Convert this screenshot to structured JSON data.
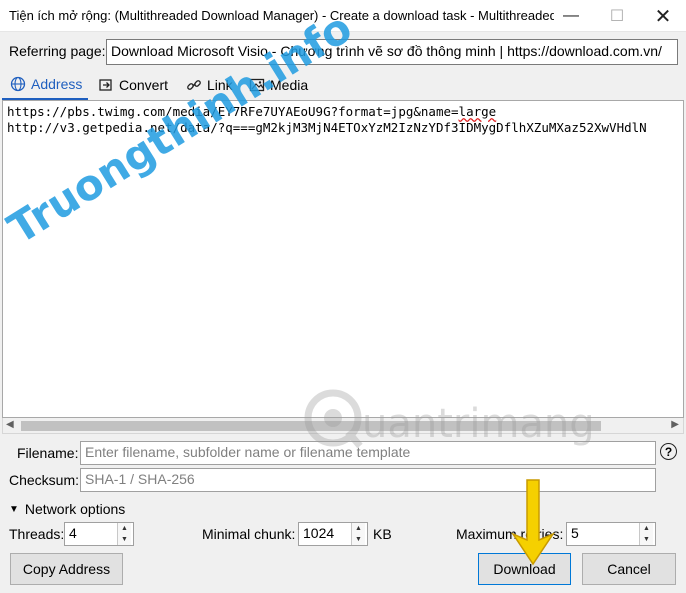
{
  "window": {
    "title": "Tiện ích mở rộng: (Multithreaded Download Manager) - Create a download task - Multithreaded Do...",
    "minimize": "—",
    "maximize": "☐",
    "close": "✕"
  },
  "referring": {
    "label": "Referring page:",
    "value": "Download Microsoft Visio - Chương trình vẽ sơ đồ thông minh | https://download.com.vn/"
  },
  "tabs": [
    {
      "label": "Address",
      "icon": "globe-icon",
      "active": true
    },
    {
      "label": "Convert",
      "icon": "convert-icon",
      "active": false
    },
    {
      "label": "Link",
      "icon": "link-icon",
      "active": false
    },
    {
      "label": "Media",
      "icon": "image-icon",
      "active": false
    }
  ],
  "urls": {
    "line1_a": "https://pbs.twimg.com/media/EY7RFe7UYAEoU9G?format=jpg&name=",
    "line1_b": "large",
    "line2": "http://v3.getpedia.net/data/?q===gM2kjM3MjN4ETOxYzM2IzNzYDf3IDMygDflhXZuMXaz52XwVHdlN"
  },
  "filename": {
    "label": "Filename:",
    "placeholder": "Enter filename, subfolder name or filename template"
  },
  "checksum": {
    "label": "Checksum:",
    "placeholder": "SHA-1 / SHA-256"
  },
  "network": {
    "label": "Network options",
    "threads_label": "Threads:",
    "threads_value": "4",
    "chunk_label": "Minimal chunk:",
    "chunk_value": "1024",
    "chunk_unit": "KB",
    "retries_label": "Maximum retries:",
    "retries_value": "5"
  },
  "buttons": {
    "copy": "Copy Address",
    "download": "Download",
    "cancel": "Cancel"
  },
  "watermarks": {
    "left": "Truongthinh.info",
    "right": "uantrimang"
  },
  "colors": {
    "accent": "#1f5fbf",
    "watermark_left": "#1f9be0",
    "watermark_left_alt": "#e0352b",
    "arrow": "#f5d000"
  }
}
